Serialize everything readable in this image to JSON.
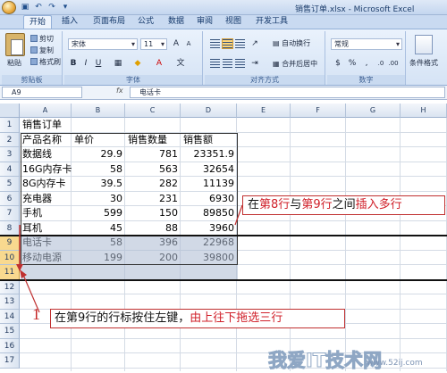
{
  "window": {
    "title": "销售订单.xlsx - Microsoft Excel"
  },
  "ribbon": {
    "tabs": [
      "开始",
      "插入",
      "页面布局",
      "公式",
      "数据",
      "审阅",
      "视图",
      "开发工具"
    ],
    "active_tab": "开始",
    "clipboard": {
      "paste": "粘贴",
      "cut": "剪切",
      "copy": "复制",
      "format_painter": "格式刷",
      "label": "剪贴板"
    },
    "font": {
      "name": "宋体",
      "size": "11",
      "label": "字体"
    },
    "alignment": {
      "wrap": "自动换行",
      "merge": "合并后居中",
      "label": "对齐方式"
    },
    "number": {
      "format": "常规",
      "label": "数字"
    },
    "styles": {
      "conditional": "条件格式"
    }
  },
  "formula_bar": {
    "name_box": "A9",
    "fx": "fx",
    "value": "电话卡"
  },
  "sheet": {
    "columns": [
      "A",
      "B",
      "C",
      "D",
      "E",
      "F",
      "G",
      "H"
    ],
    "rows": [
      "1",
      "2",
      "3",
      "4",
      "5",
      "6",
      "7",
      "8",
      "9",
      "10",
      "11",
      "12",
      "13",
      "14",
      "15",
      "16",
      "17"
    ],
    "title": "销售订单",
    "headers": [
      "产品名称",
      "单价",
      "销售数量",
      "销售额"
    ],
    "data": [
      [
        "数据线",
        "29.9",
        "781",
        "23351.9"
      ],
      [
        "16G内存卡",
        "58",
        "563",
        "32654"
      ],
      [
        "8G内存卡",
        "39.5",
        "282",
        "11139"
      ],
      [
        "充电器",
        "30",
        "231",
        "6930"
      ],
      [
        "手机",
        "599",
        "150",
        "89850"
      ],
      [
        "耳机",
        "45",
        "88",
        "3960"
      ],
      [
        "电话卡",
        "58",
        "396",
        "22968"
      ],
      [
        "移动电源",
        "199",
        "200",
        "39800"
      ]
    ]
  },
  "annotations": {
    "note1_pre": "在",
    "note1_hl1": "第8行",
    "note1_mid": "与",
    "note1_hl2": "第9行",
    "note1_mid2": "之间",
    "note1_hl3": "插入多行",
    "note2_pre": "在第9行的行标按住左键，",
    "note2_hl": "由上往下拖选三行",
    "step_number": "1"
  },
  "watermark": {
    "main": "我爱IT技术网",
    "sub": "www.52ij.com"
  }
}
